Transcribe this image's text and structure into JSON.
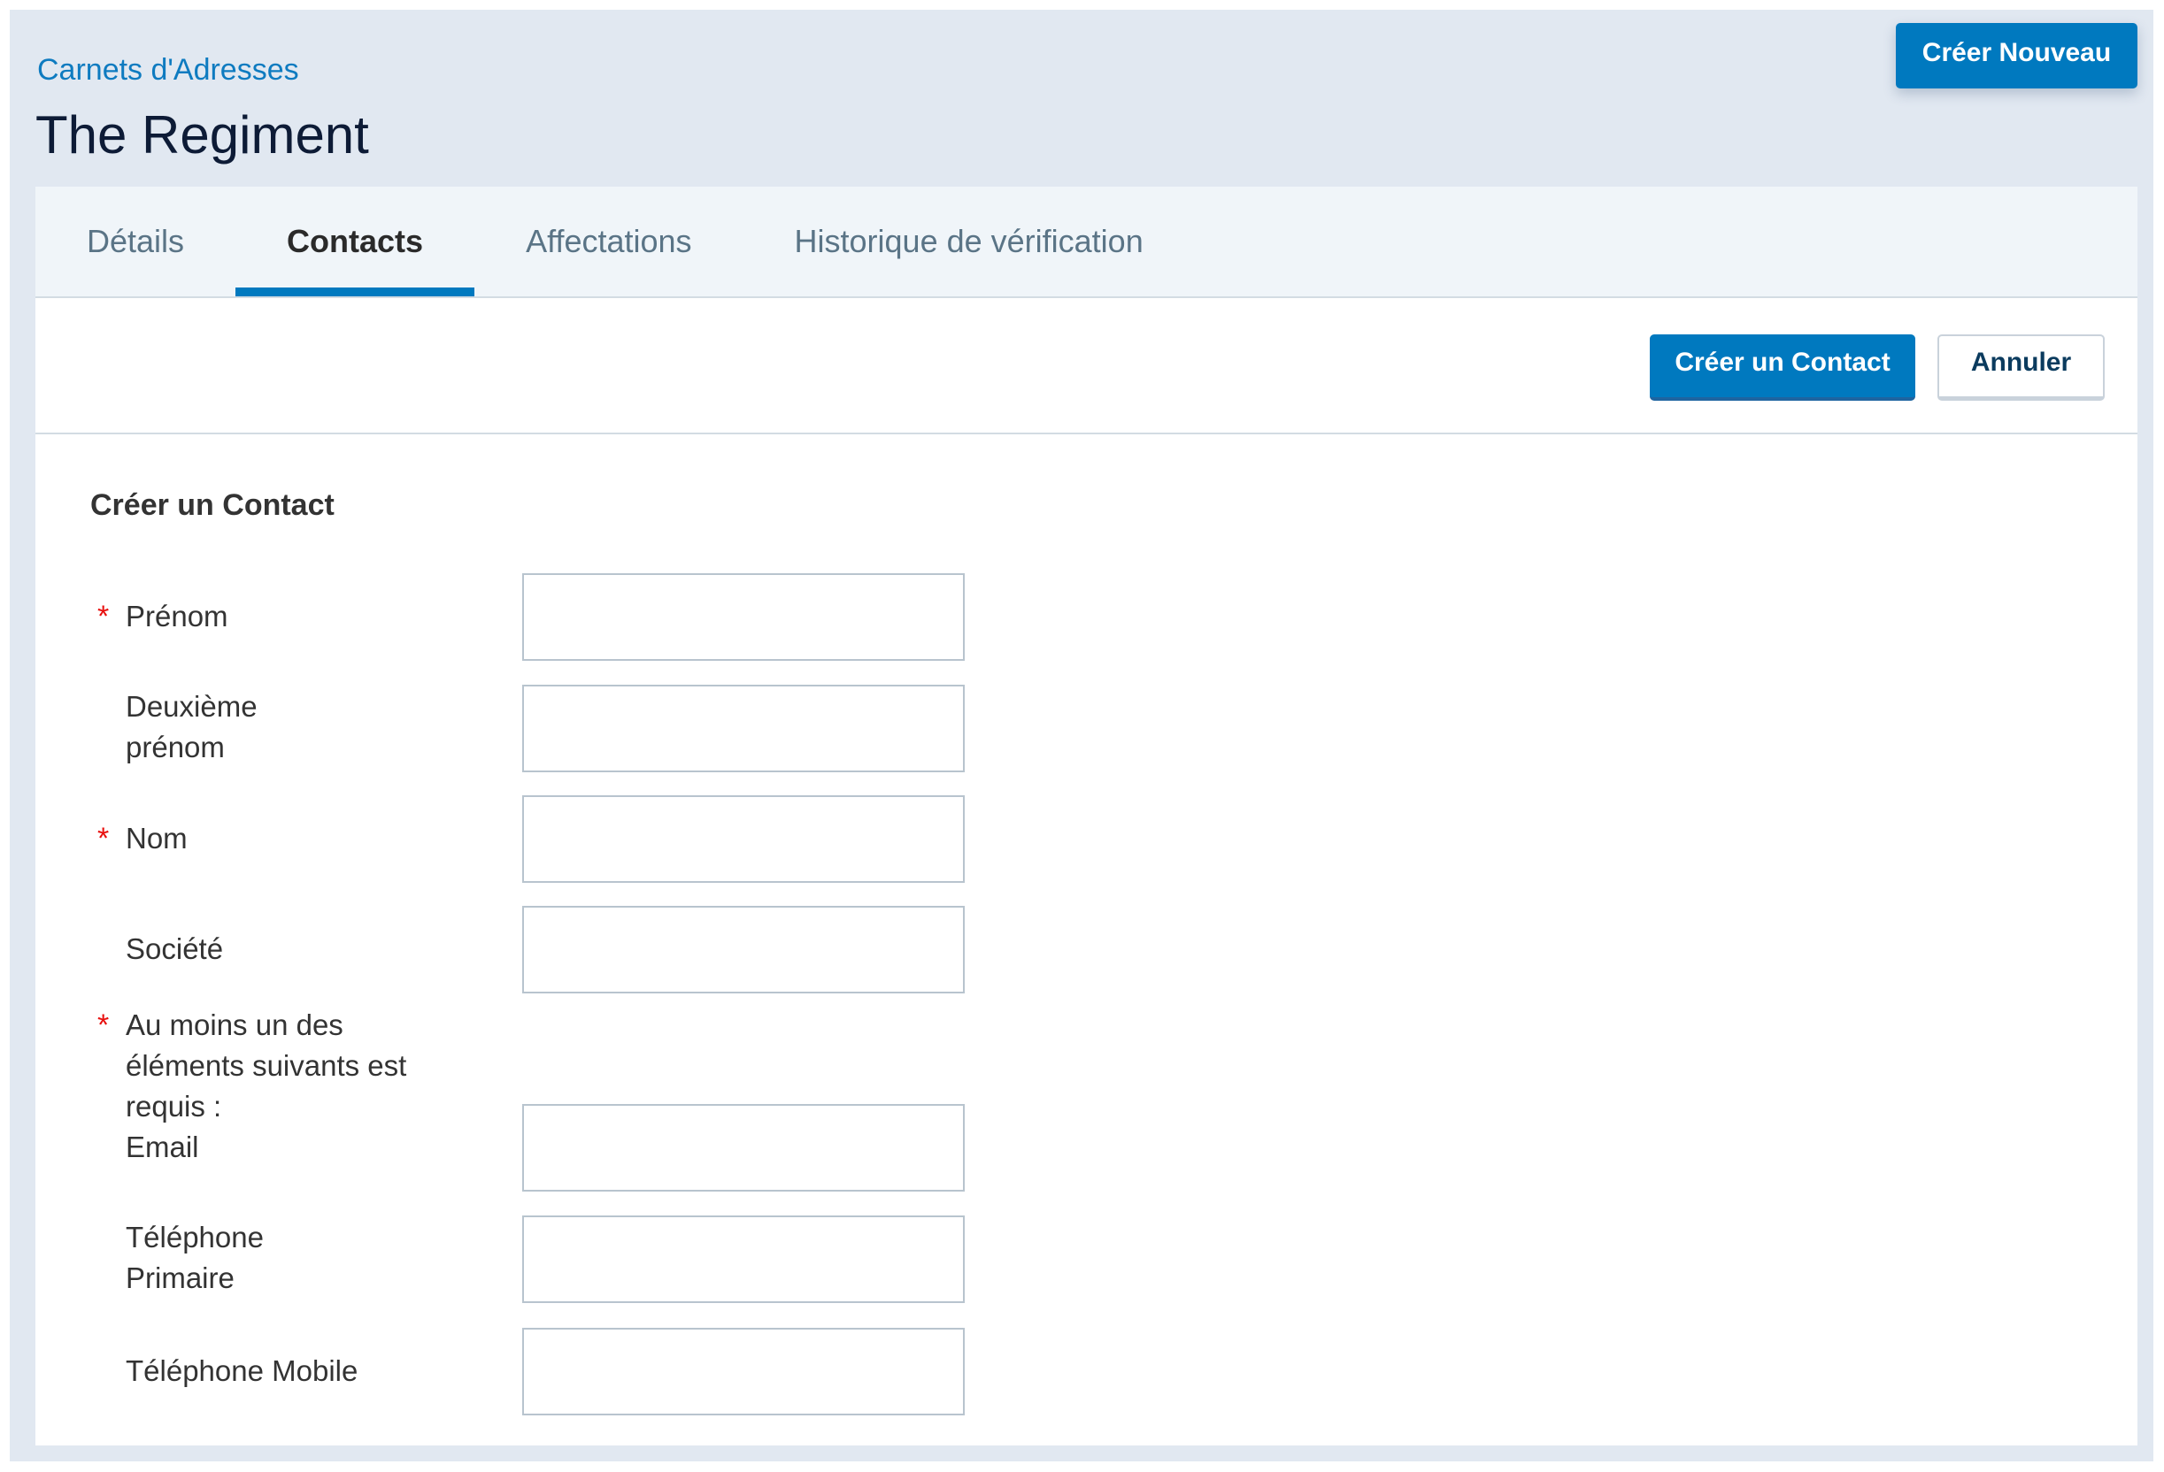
{
  "header": {
    "breadcrumb": "Carnets d'Adresses",
    "title": "The Regiment",
    "create_new_label": "Créer Nouveau"
  },
  "tabs": [
    {
      "label": "Détails",
      "active": false
    },
    {
      "label": "Contacts",
      "active": true
    },
    {
      "label": "Affectations",
      "active": false
    },
    {
      "label": "Historique de vérification",
      "active": false
    }
  ],
  "actions": {
    "create_contact_label": "Créer un Contact",
    "cancel_label": "Annuler"
  },
  "form": {
    "title": "Créer un Contact",
    "required_marker": "*",
    "fields": {
      "first_name": {
        "label": "Prénom",
        "required": true,
        "value": ""
      },
      "middle_name": {
        "label": "Deuxième prénom",
        "required": false,
        "value": ""
      },
      "last_name": {
        "label": "Nom",
        "required": true,
        "value": ""
      },
      "company": {
        "label": "Société",
        "required": false,
        "value": ""
      },
      "email": {
        "label": "Email",
        "required": false,
        "value": ""
      },
      "primary_phone": {
        "label": "Téléphone Primaire",
        "required": false,
        "value": ""
      },
      "mobile_phone": {
        "label": "Téléphone Mobile",
        "required": false,
        "value": ""
      }
    },
    "at_least_one_note": "Au moins un des éléments suivants est requis :"
  },
  "colors": {
    "accent": "#0079BF",
    "required": "#E8100E",
    "page_background": "#E1E8F1"
  }
}
